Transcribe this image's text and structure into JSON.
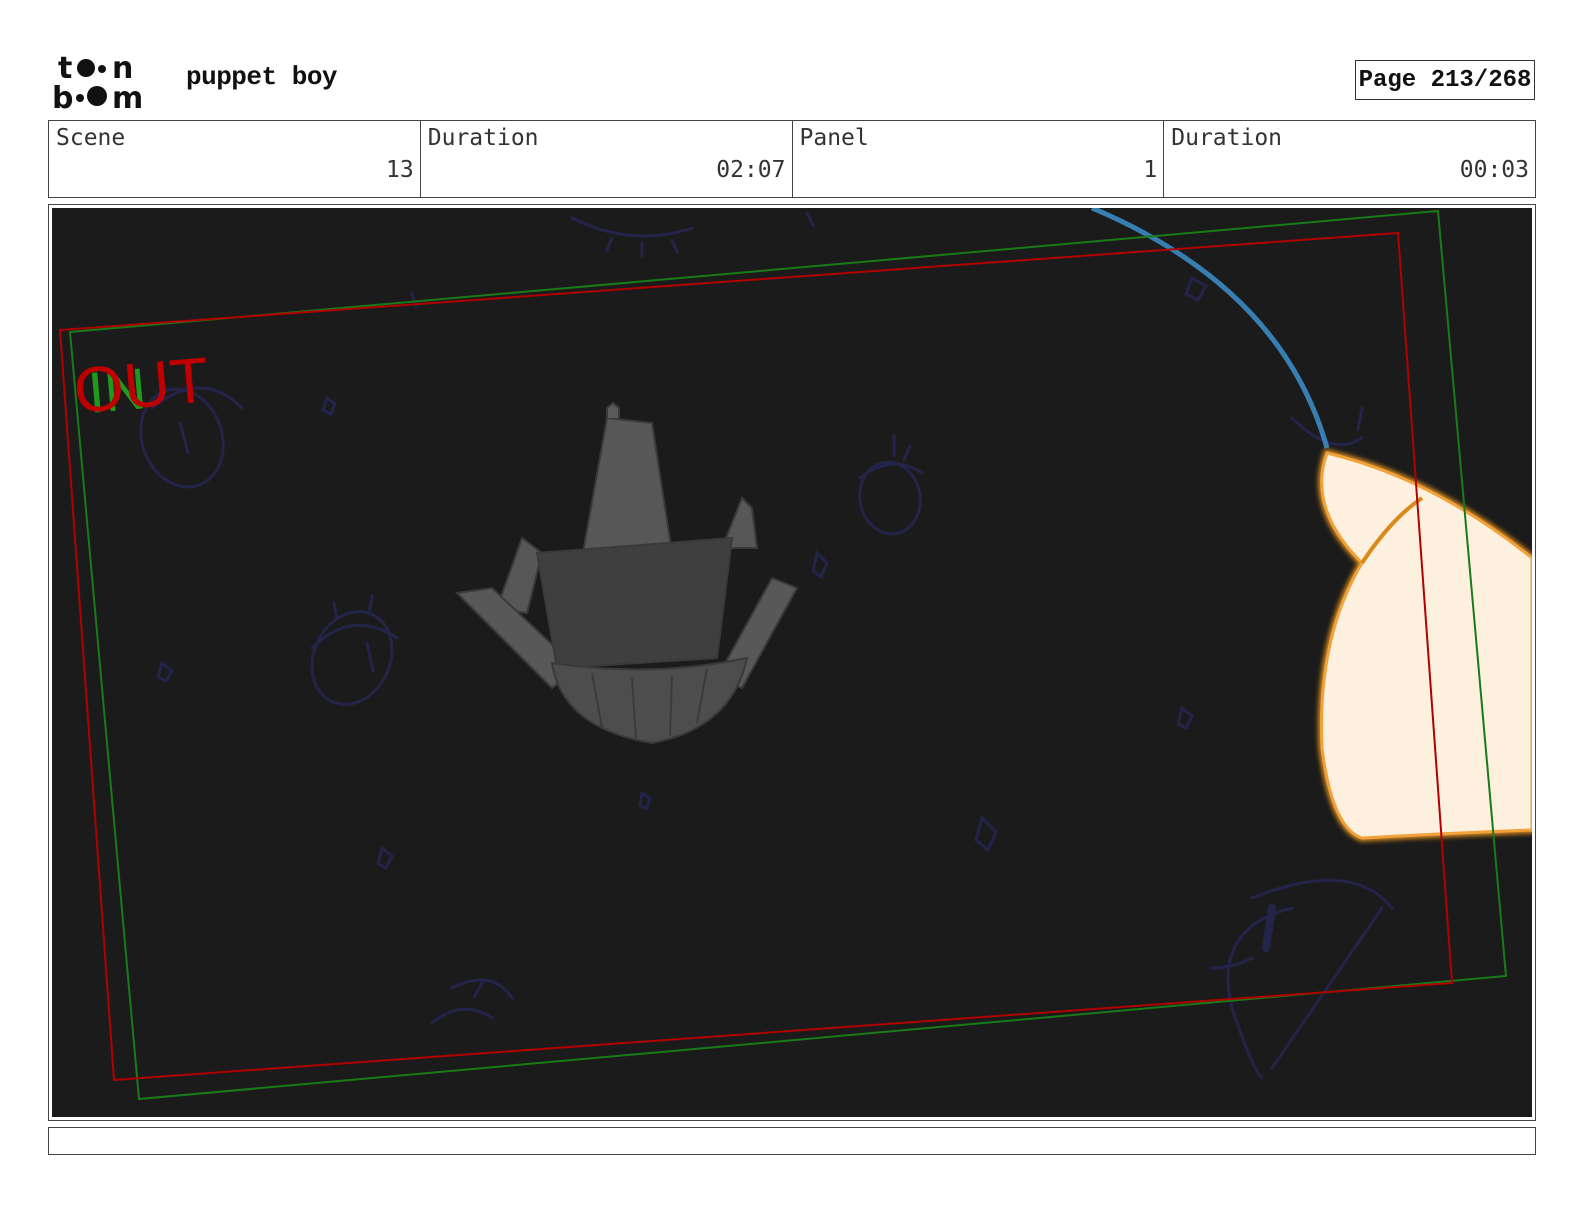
{
  "header": {
    "logo_alt": "toon boom",
    "project_title": "puppet boy",
    "page_label": "Page 213/268"
  },
  "info": {
    "scene_label": "Scene",
    "scene_value": "13",
    "scene_duration_label": "Duration",
    "scene_duration_value": "02:07",
    "panel_label": "Panel",
    "panel_value": "1",
    "panel_duration_label": "Duration",
    "panel_duration_value": "00:03"
  },
  "panel": {
    "background_color": "#1b1b1b",
    "in_marker": "IN",
    "out_marker": "OUT",
    "in_color": "#1f9a1f",
    "out_color": "#c00000"
  },
  "notes": {
    "text": ""
  }
}
